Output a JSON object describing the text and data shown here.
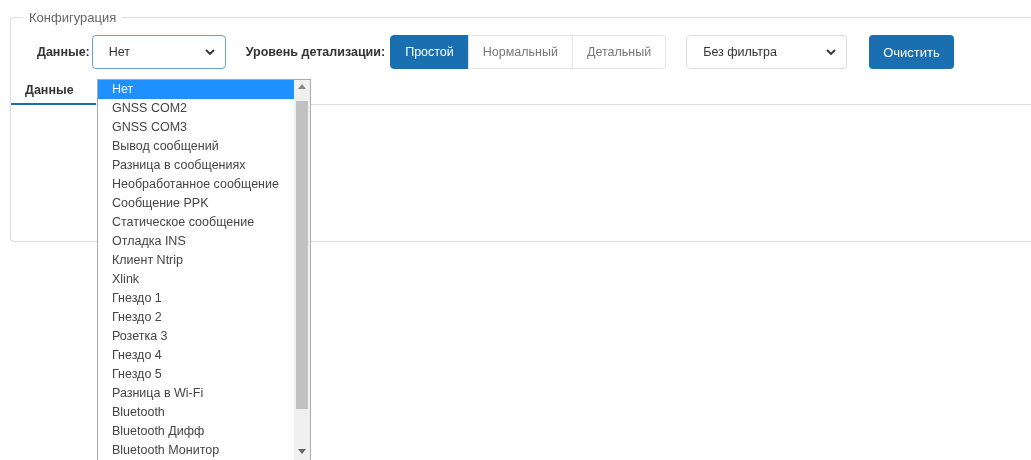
{
  "fieldset": {
    "legend": "Конфигурация"
  },
  "data_select": {
    "label": "Данные:",
    "value": "Нет"
  },
  "detail_level": {
    "label": "Уровень детализации:",
    "options": [
      {
        "label": "Простой",
        "selected": true
      },
      {
        "label": "Нормальный",
        "selected": false
      },
      {
        "label": "Детальный",
        "selected": false
      }
    ]
  },
  "filter_select": {
    "value": "Без фильтра"
  },
  "clear_button": "Очистить",
  "tabs": [
    {
      "label": "Данные",
      "selected": true
    }
  ],
  "dropdown": {
    "options": [
      {
        "label": "Нет",
        "selected": true
      },
      {
        "label": "GNSS COM2",
        "selected": false
      },
      {
        "label": "GNSS COM3",
        "selected": false
      },
      {
        "label": "Вывод сообщений",
        "selected": false
      },
      {
        "label": "Разница в сообщениях",
        "selected": false
      },
      {
        "label": "Необработанное сообщение",
        "selected": false
      },
      {
        "label": "Сообщение PPK",
        "selected": false
      },
      {
        "label": "Статическое сообщение",
        "selected": false
      },
      {
        "label": "Отладка INS",
        "selected": false
      },
      {
        "label": "Клиент Ntrip",
        "selected": false
      },
      {
        "label": "Xlink",
        "selected": false
      },
      {
        "label": "Гнездо 1",
        "selected": false
      },
      {
        "label": "Гнездо 2",
        "selected": false
      },
      {
        "label": "Розетка 3",
        "selected": false
      },
      {
        "label": "Гнездо 4",
        "selected": false
      },
      {
        "label": "Гнездо 5",
        "selected": false
      },
      {
        "label": "Разница в Wi-Fi",
        "selected": false
      },
      {
        "label": "Bluetooth",
        "selected": false
      },
      {
        "label": "Bluetooth Дифф",
        "selected": false
      },
      {
        "label": "Bluetooth Монитор",
        "selected": false
      }
    ]
  }
}
